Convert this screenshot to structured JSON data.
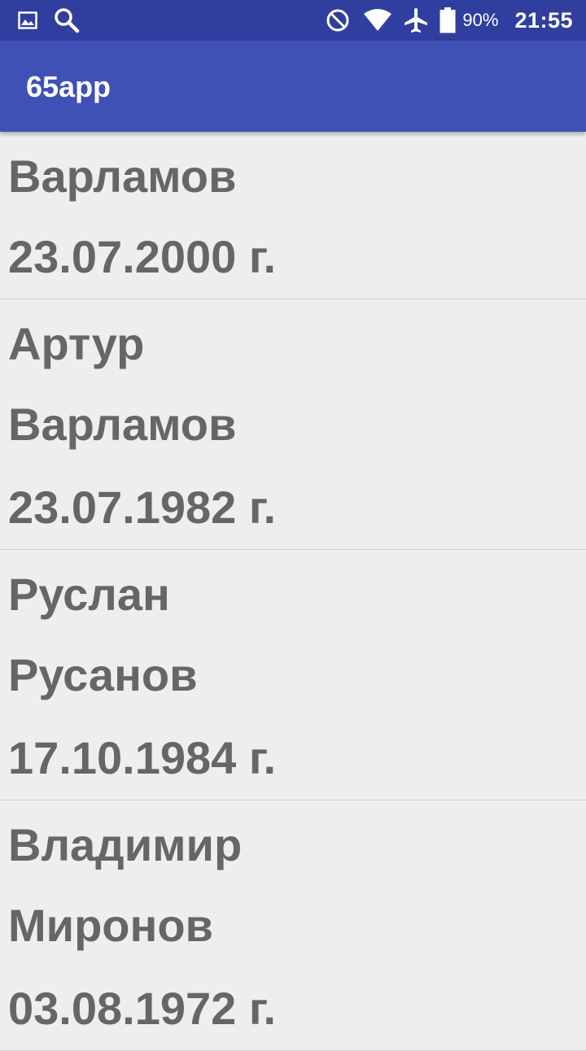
{
  "status_bar": {
    "left_icons": [
      "image-icon",
      "search-icon"
    ],
    "right_icons": [
      "do-not-disturb-icon",
      "wifi-icon",
      "airplane-icon",
      "battery-icon"
    ],
    "battery_percent": "90%",
    "time": "21:55"
  },
  "app_bar": {
    "title": "65app"
  },
  "list": {
    "items": [
      {
        "lines": [
          "Варламов",
          "23.07.2000 г."
        ]
      },
      {
        "lines": [
          "Артур",
          "Варламов",
          "23.07.1982 г."
        ]
      },
      {
        "lines": [
          "Руслан",
          "Русанов",
          "17.10.1984 г."
        ]
      },
      {
        "lines": [
          "Владимир",
          "Миронов",
          "03.08.1972 г."
        ]
      }
    ]
  },
  "colors": {
    "status_bar": "#303f9f",
    "app_bar": "#3f51b5",
    "background": "#eeeeee",
    "text": "#666666",
    "divider": "#cfcfcf"
  }
}
